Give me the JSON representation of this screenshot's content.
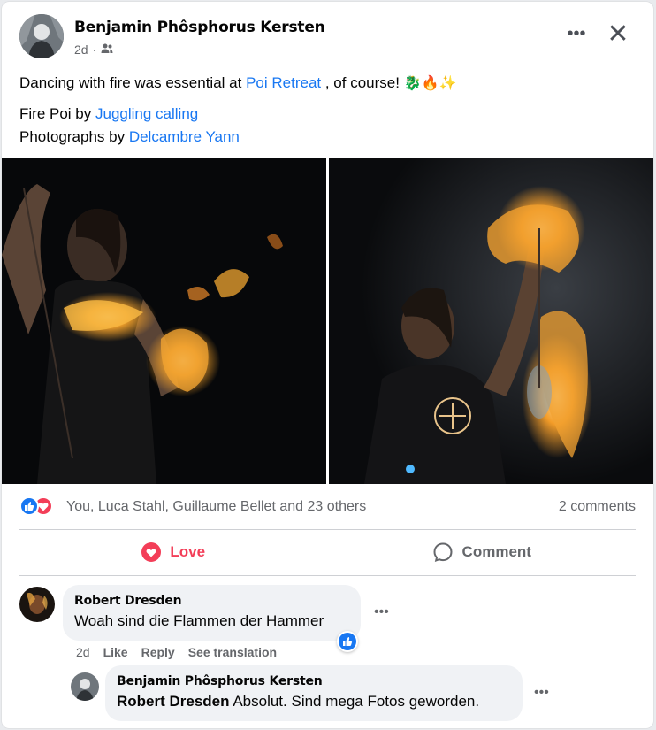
{
  "post": {
    "author": "Benjamin Phôsphorus Kersten",
    "time": "2d",
    "privacy_icon": "friends-icon",
    "more_label": "•••",
    "close_label": "✕",
    "text_lead": "Dancing with fire was essential at",
    "text_link_1": "Poi Retreat",
    "text_tail": ", of course!",
    "text_emojis": "🐉🔥✨",
    "line2_lead": "Fire Poi by",
    "line2_link": "Juggling calling",
    "line3_lead": "Photographs by",
    "line3_link": "Delcambre Yann"
  },
  "photos": [
    {
      "icon": "fire-poi-photo-1"
    },
    {
      "icon": "fire-poi-photo-2"
    }
  ],
  "reactions": {
    "icons": [
      "like-icon",
      "love-icon"
    ],
    "summary": "You, Luca Stahl, Guillaume Bellet and 23 others",
    "comment_count": "2 comments"
  },
  "actions": {
    "love_label": "Love",
    "comment_label": "Comment"
  },
  "comments": [
    {
      "author": "Robert Dresden",
      "text": "Woah sind die Flammen der Hammer",
      "time": "2d",
      "like_label": "Like",
      "reply_label": "Reply",
      "translate_label": "See translation",
      "more_label": "•••"
    },
    {
      "author": "Benjamin Phôsphorus Kersten",
      "mention": "Robert Dresden",
      "text": "Absolut. Sind mega Fotos geworden.",
      "more_label": "•••"
    }
  ],
  "colors": {
    "link": "#1877f2",
    "love": "#f33e58",
    "like": "#1877f2",
    "secondary_text": "#65676b",
    "bubble": "#f0f2f5"
  }
}
